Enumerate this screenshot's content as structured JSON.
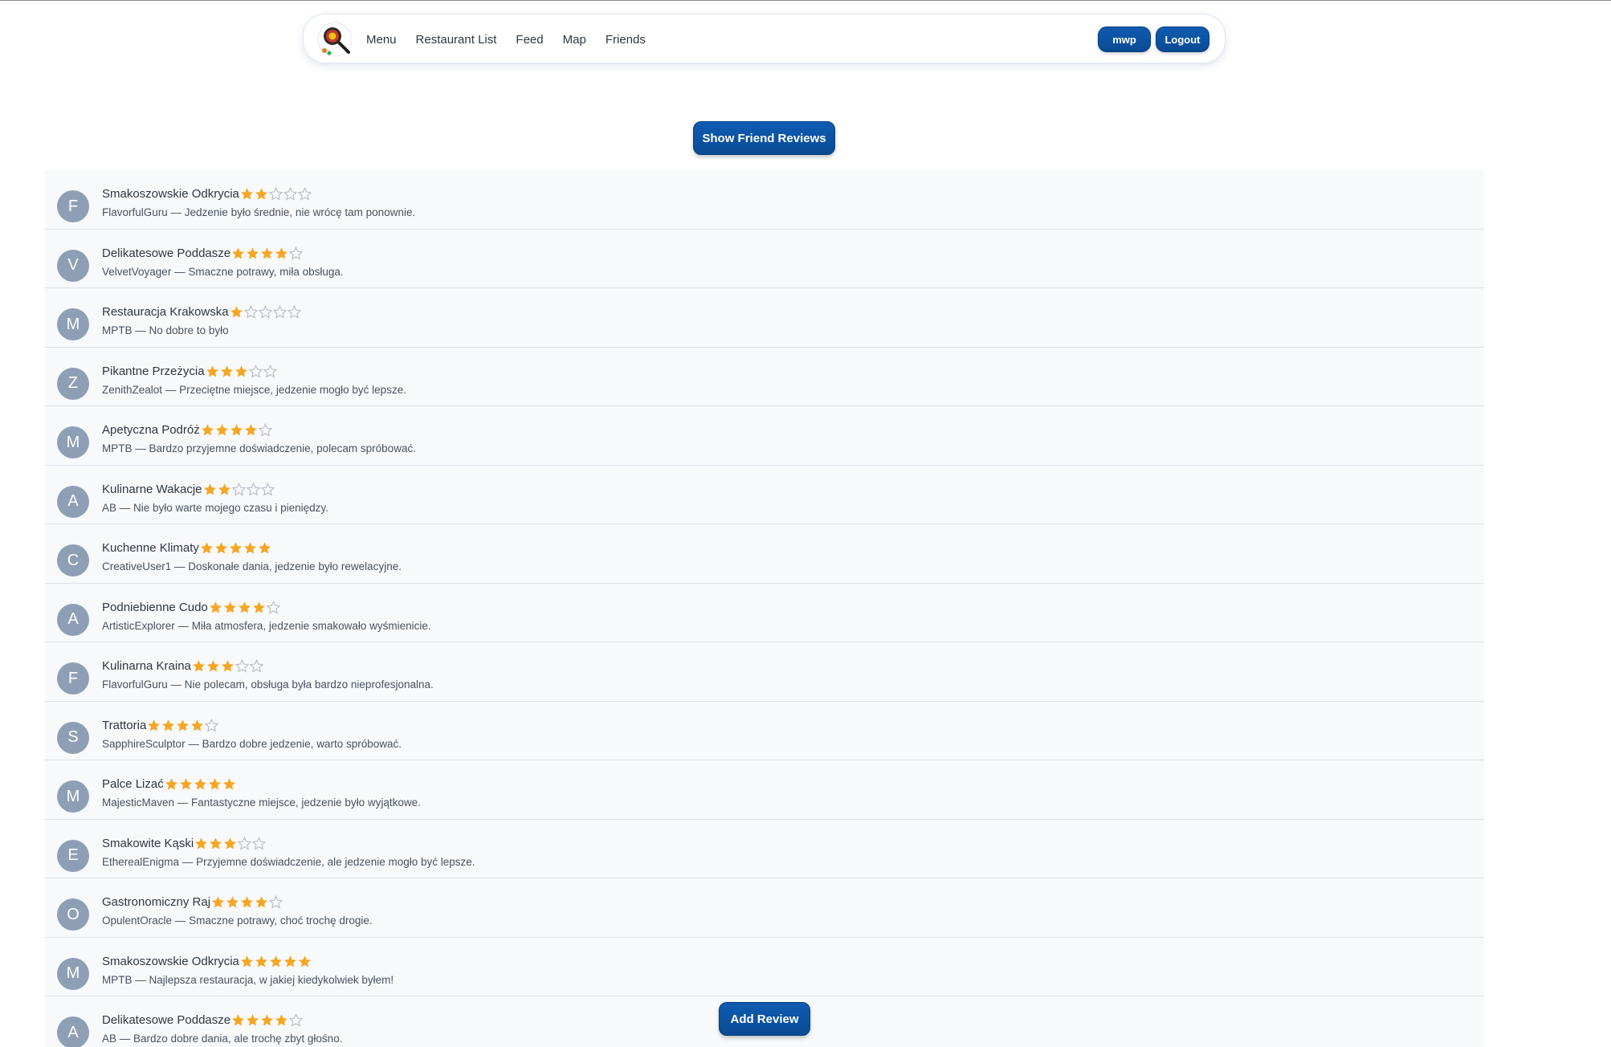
{
  "nav": {
    "links": [
      "Menu",
      "Restaurant List",
      "Feed",
      "Map",
      "Friends"
    ],
    "user_button": "mwp",
    "logout_button": "Logout",
    "theme_icon": "moon-icon"
  },
  "actions": {
    "show_friend_reviews": "Show Friend Reviews",
    "add_review": "Add Review"
  },
  "colors": {
    "primary": "#0a4f9e",
    "star_filled": "#f5a623",
    "star_empty": "#b9bfc7",
    "avatar_bg": "#8e9fb5"
  },
  "reviews": [
    {
      "initial": "F",
      "restaurant": "Smakoszowskie Odkrycia",
      "rating": 2,
      "author": "FlavorfulGuru",
      "comment": "Jedzenie było średnie, nie wrócę tam ponownie."
    },
    {
      "initial": "V",
      "restaurant": "Delikatesowe Poddasze",
      "rating": 4,
      "author": "VelvetVoyager",
      "comment": "Smaczne potrawy, miła obsługa."
    },
    {
      "initial": "M",
      "restaurant": "Restauracja Krakowska",
      "rating": 1,
      "author": "MPTB",
      "comment": "No dobre to było"
    },
    {
      "initial": "Z",
      "restaurant": "Pikantne Przeżycia",
      "rating": 3,
      "author": "ZenithZealot",
      "comment": "Przeciętne miejsce, jedzenie mogło być lepsze."
    },
    {
      "initial": "M",
      "restaurant": "Apetyczna Podróż",
      "rating": 4,
      "author": "MPTB",
      "comment": "Bardzo przyjemne doświadczenie, polecam spróbować."
    },
    {
      "initial": "A",
      "restaurant": "Kulinarne Wakacje",
      "rating": 2,
      "author": "AB",
      "comment": "Nie było warte mojego czasu i pieniędzy."
    },
    {
      "initial": "C",
      "restaurant": "Kuchenne Klimaty",
      "rating": 5,
      "author": "CreativeUser1",
      "comment": "Doskonałe dania, jedzenie było rewelacyjne."
    },
    {
      "initial": "A",
      "restaurant": "Podniebienne Cudo",
      "rating": 4,
      "author": "ArtisticExplorer",
      "comment": "Miła atmosfera, jedzenie smakowało wyśmienicie."
    },
    {
      "initial": "F",
      "restaurant": "Kulinarna Kraina",
      "rating": 3,
      "author": "FlavorfulGuru",
      "comment": "Nie polecam, obsługa była bardzo nieprofesjonalna."
    },
    {
      "initial": "S",
      "restaurant": "Trattoria",
      "rating": 4,
      "author": "SapphireSculptor",
      "comment": "Bardzo dobre jedzenie, warto spróbować."
    },
    {
      "initial": "M",
      "restaurant": "Palce Lizać",
      "rating": 5,
      "author": "MajesticMaven",
      "comment": "Fantastyczne miejsce, jedzenie było wyjątkowe."
    },
    {
      "initial": "E",
      "restaurant": "Smakowite Kąski",
      "rating": 3,
      "author": "EtherealEnigma",
      "comment": "Przyjemne doświadczenie, ale jedzenie mogło być lepsze."
    },
    {
      "initial": "O",
      "restaurant": "Gastronomiczny Raj",
      "rating": 4,
      "author": "OpulentOracle",
      "comment": "Smaczne potrawy, choć trochę drogie."
    },
    {
      "initial": "M",
      "restaurant": "Smakoszowskie Odkrycia",
      "rating": 5,
      "author": "MPTB",
      "comment": "Najlepsza restauracja, w jakiej kiedykolwiek byłem!"
    },
    {
      "initial": "A",
      "restaurant": "Delikatesowe Poddasze",
      "rating": 4,
      "author": "AB",
      "comment": "Bardzo dobre dania, ale trochę zbyt głośno."
    }
  ]
}
